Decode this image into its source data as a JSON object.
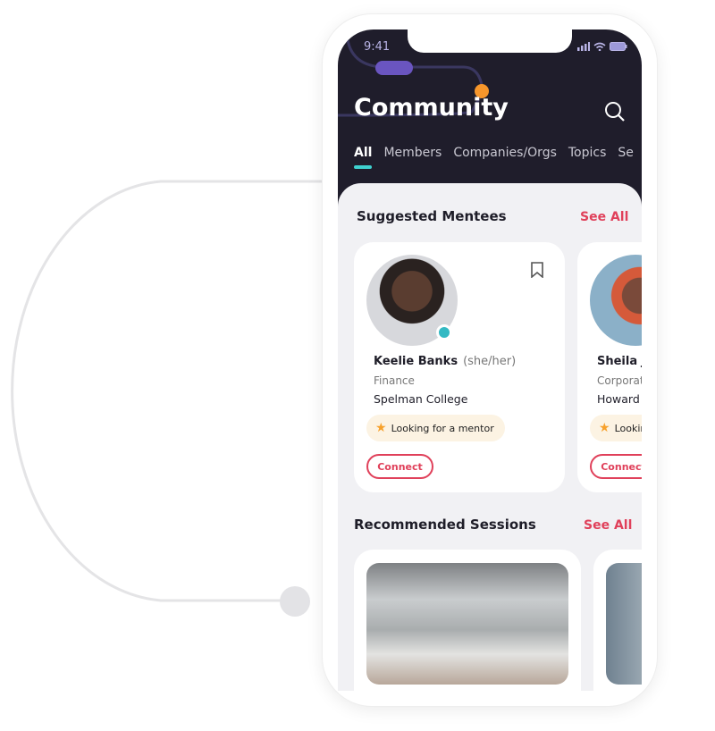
{
  "status": {
    "time": "9:41"
  },
  "header": {
    "title": "Community"
  },
  "tabs": [
    "All",
    "Members",
    "Companies/Orgs",
    "Topics",
    "Se"
  ],
  "mentees": {
    "title": "Suggested Mentees",
    "see_all": "See All",
    "cards": [
      {
        "name": "Keelie Banks",
        "pronouns": "(she/her)",
        "field": "Finance",
        "school": "Spelman College",
        "tag": "Looking for a mentor",
        "action": "Connect"
      },
      {
        "name": "Sheila J",
        "pronouns": "",
        "field": "Corporat",
        "school": "Howard U",
        "tag": "Lookin",
        "action": "Connect"
      }
    ]
  },
  "sessions": {
    "title": "Recommended Sessions",
    "see_all": "See All"
  },
  "colors": {
    "accent": "#e0405a",
    "header_bg": "#1f1d2b",
    "tab_indicator": "#3fd1cf",
    "star": "#f7a12b",
    "online": "#33b9c3"
  }
}
